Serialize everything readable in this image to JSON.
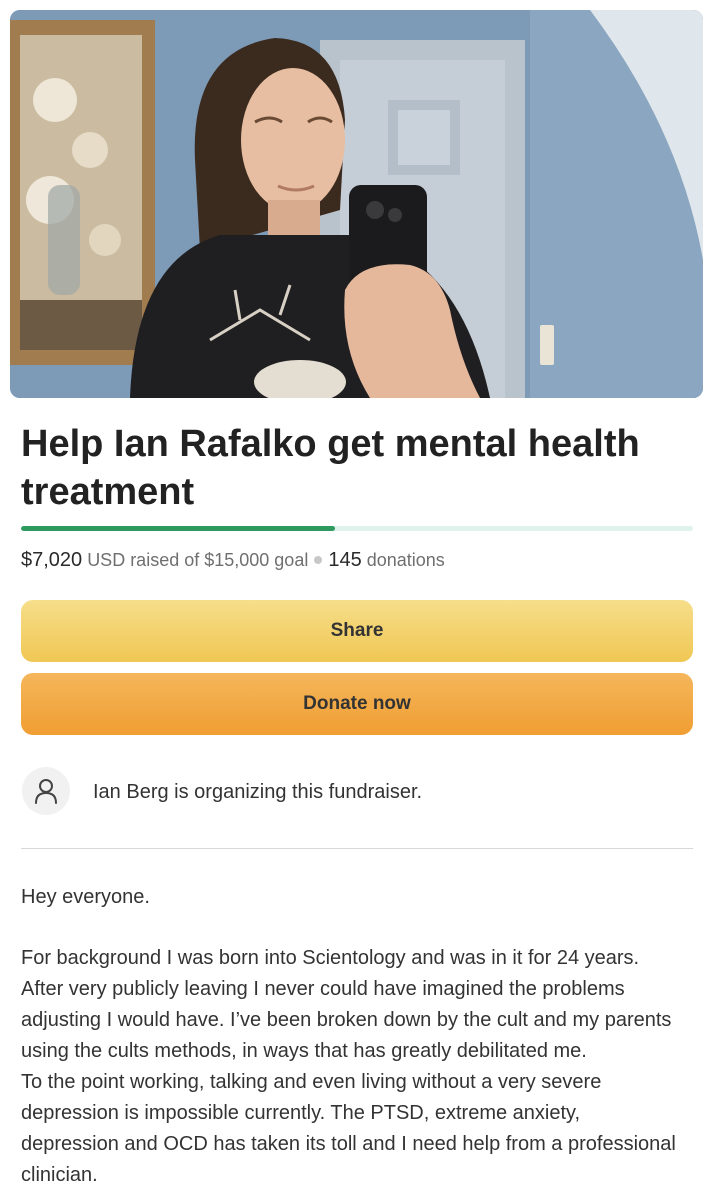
{
  "hero": {
    "image": "selfie-photo"
  },
  "campaign": {
    "title": "Help Ian Rafalko get mental health treatment",
    "raised": "$7,020",
    "raised_suffix": "USD raised of $15,000 goal",
    "donations_count": "145",
    "donations_label": "donations",
    "progress_fraction": 0.468
  },
  "actions": {
    "share_label": "Share",
    "donate_label": "Donate now"
  },
  "organizer": {
    "icon": "user-icon",
    "text": "Ian Berg is organizing this fundraiser."
  },
  "story": {
    "greeting": "Hey everyone.",
    "lines": [
      "For background I was born into Scientology and was in it for 24 years.",
      "After very publicly leaving I never could have imagined the problems",
      "adjusting I would have. I’ve been broken down by the cult and my parents",
      "using the cults methods, in ways that has greatly debilitated me.",
      "To the point working, talking and even living without a very severe",
      "depression is impossible currently. The PTSD, extreme anxiety,",
      "depression and OCD has taken its toll and I need help from a professional",
      "clinician."
    ]
  },
  "colors": {
    "progress_fill": "#2f9a60",
    "progress_track": "#dff3ec",
    "share_button": "#f0c754",
    "donate_button": "#f09e32"
  }
}
